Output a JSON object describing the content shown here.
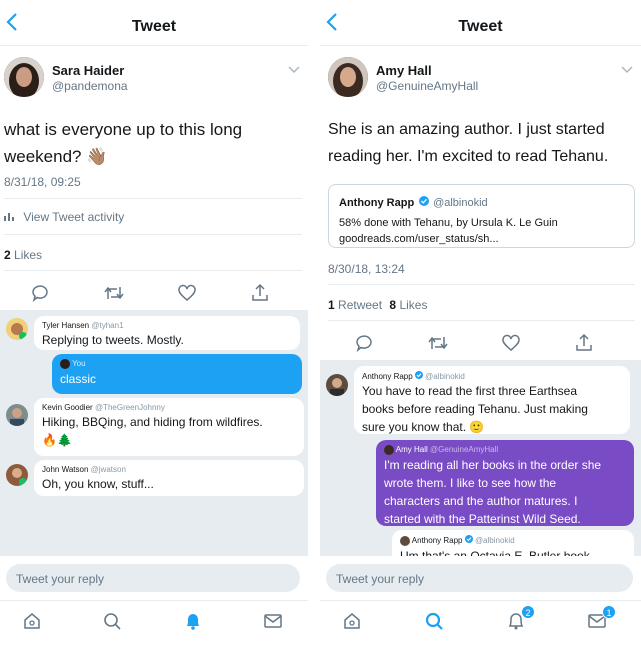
{
  "left": {
    "header": {
      "back_icon": "chevron-left-icon",
      "title": "Tweet"
    },
    "tweet": {
      "author_name": "Sara Haider",
      "author_handle": "@pandemona",
      "text_line1": "what is everyone up to this long",
      "text_line2": "weekend? 👋🏽",
      "timestamp": "8/31/18, 09:25",
      "activity_label": "View Tweet activity",
      "likes_count": "2",
      "likes_label": "Likes"
    },
    "replies": [
      {
        "name": "Tyler Hansen",
        "handle": "@tyhan1",
        "text": "Replying to tweets. Mostly."
      },
      {
        "name": "You",
        "text": "classic"
      },
      {
        "name": "Kevin Goodier",
        "handle": "@TheGreenJohnny",
        "text": "Hiking, BBQing, and hiding from wildfires.",
        "emoji": "🔥🌲"
      },
      {
        "name": "John Watson",
        "handle": "@jwatson",
        "text": "Oh, you know, stuff..."
      }
    ],
    "reply_placeholder": "Tweet your reply"
  },
  "right": {
    "header": {
      "back_icon": "chevron-left-icon",
      "title": "Tweet"
    },
    "tweet": {
      "author_name": "Amy Hall",
      "author_handle": "@GenuineAmyHall",
      "text_line1": "She is an amazing author. I just started",
      "text_line2": "reading her.  I'm excited to read Tehanu.",
      "quote_name": "Anthony Rapp",
      "quote_handle": "@albinokid",
      "quote_line1": "58% done with Tehanu, by Ursula K. Le Guin",
      "quote_line2": "goodreads.com/user_status/sh...",
      "timestamp": "8/30/18, 13:24",
      "retweets_count": "1",
      "retweets_label": "Retweet",
      "likes_count": "8",
      "likes_label": "Likes"
    },
    "replies": [
      {
        "name": "Anthony Rapp",
        "handle": "@albinokid",
        "text_line1": "You have to read the first three Earthsea",
        "text_line2": "books before reading Tehanu. Just making",
        "text_line3": "sure you know that. 🙂"
      },
      {
        "name": "Amy Hall",
        "handle": "@GenuineAmyHall",
        "text_line1": "I'm reading all her books in the order she",
        "text_line2": "wrote them.  I like to see how the",
        "text_line3": "characters and the author matures.  I",
        "text_line4": "started with the Patterinst Wild Seed."
      },
      {
        "name": "Anthony Rapp",
        "handle": "@albinokid",
        "text": "Um that's an Octavia E. Butler book"
      }
    ],
    "reply_placeholder": "Tweet your reply",
    "notifications_badge": "2",
    "messages_badge": "1"
  },
  "colors": {
    "accent": "#1da1f2",
    "purple_bubble": "#794bc4",
    "thread_bg": "#e6ecf0",
    "muted_text": "#657786"
  },
  "icons": {
    "actions": [
      "reply-icon",
      "retweet-icon",
      "heart-icon",
      "share-icon"
    ],
    "tabs": [
      "home-icon",
      "search-icon",
      "bell-icon",
      "mail-icon"
    ]
  }
}
